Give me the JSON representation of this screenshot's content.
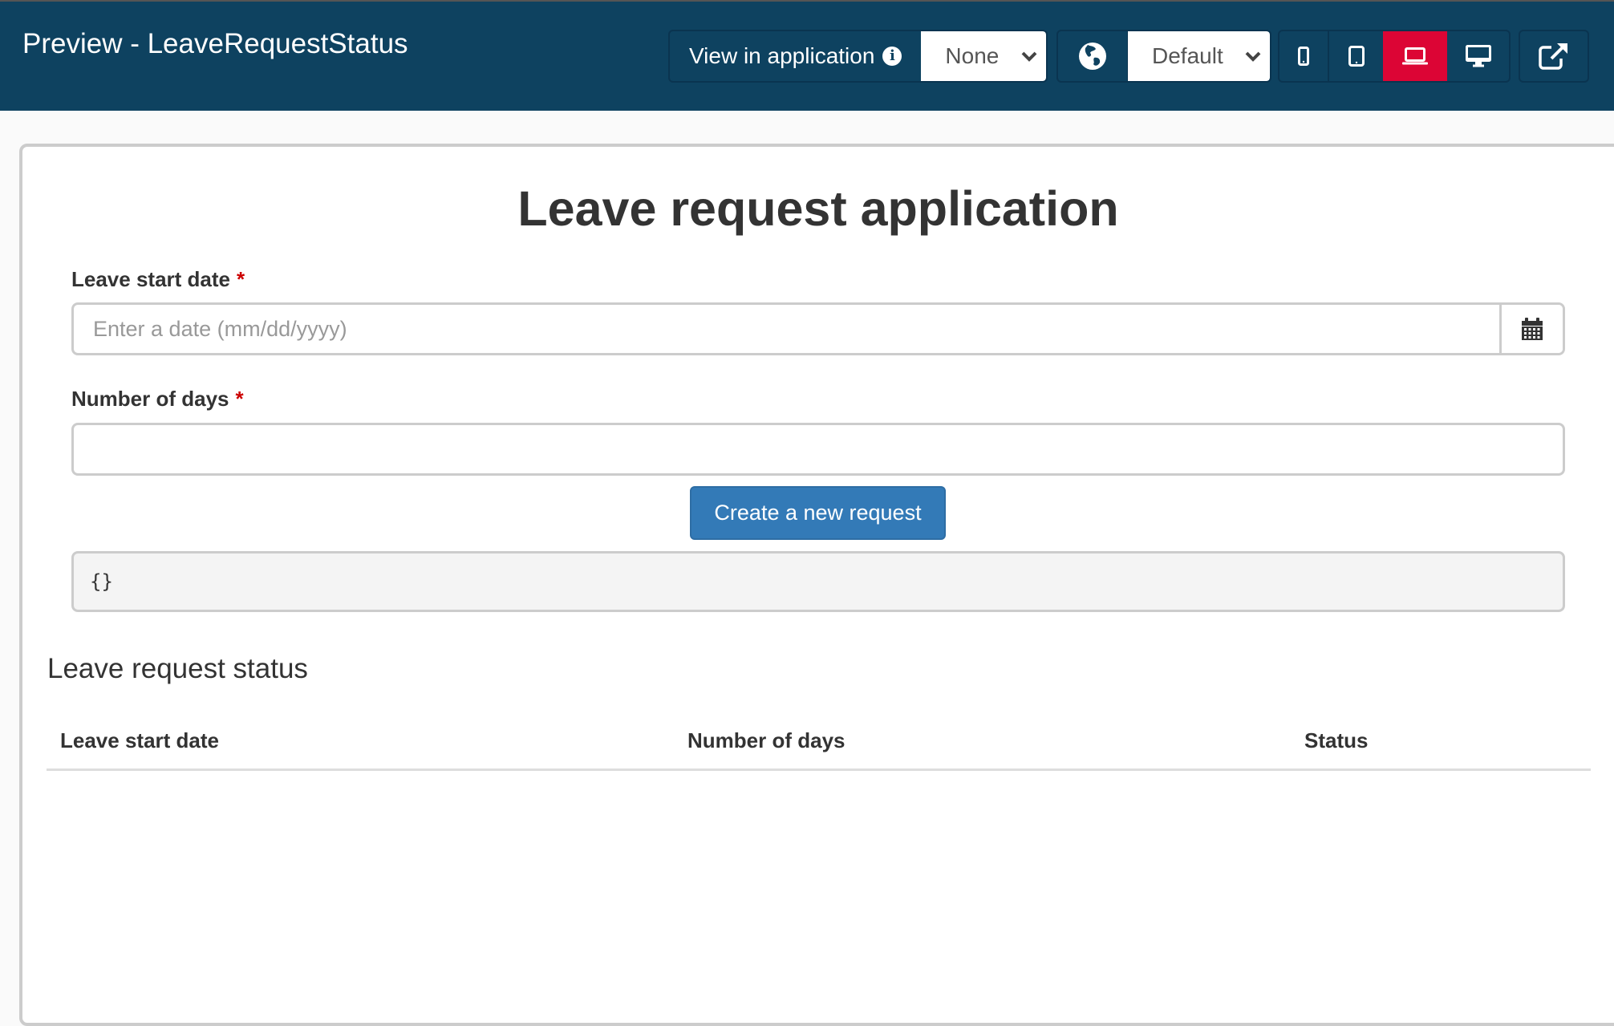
{
  "header": {
    "title": "Preview - LeaveRequestStatus",
    "view_in_app_label": "View in application",
    "view_in_app_select": "None",
    "locale_select": "Default",
    "device_buttons": [
      {
        "name": "mobile",
        "active": false
      },
      {
        "name": "tablet",
        "active": false
      },
      {
        "name": "laptop",
        "active": true
      },
      {
        "name": "desktop",
        "active": false
      }
    ],
    "active_color": "#dc0535",
    "bar_color": "#0e4260"
  },
  "form": {
    "title": "Leave request application",
    "start_date": {
      "label": "Leave start date",
      "required_marker": "*",
      "placeholder": "Enter a date (mm/dd/yyyy)",
      "value": ""
    },
    "num_days": {
      "label": "Number of days",
      "required_marker": "*",
      "value": ""
    },
    "submit_label": "Create a new request",
    "output": "{}"
  },
  "status": {
    "title": "Leave request status",
    "columns": [
      "Leave start date",
      "Number of days",
      "Status"
    ],
    "rows": []
  }
}
